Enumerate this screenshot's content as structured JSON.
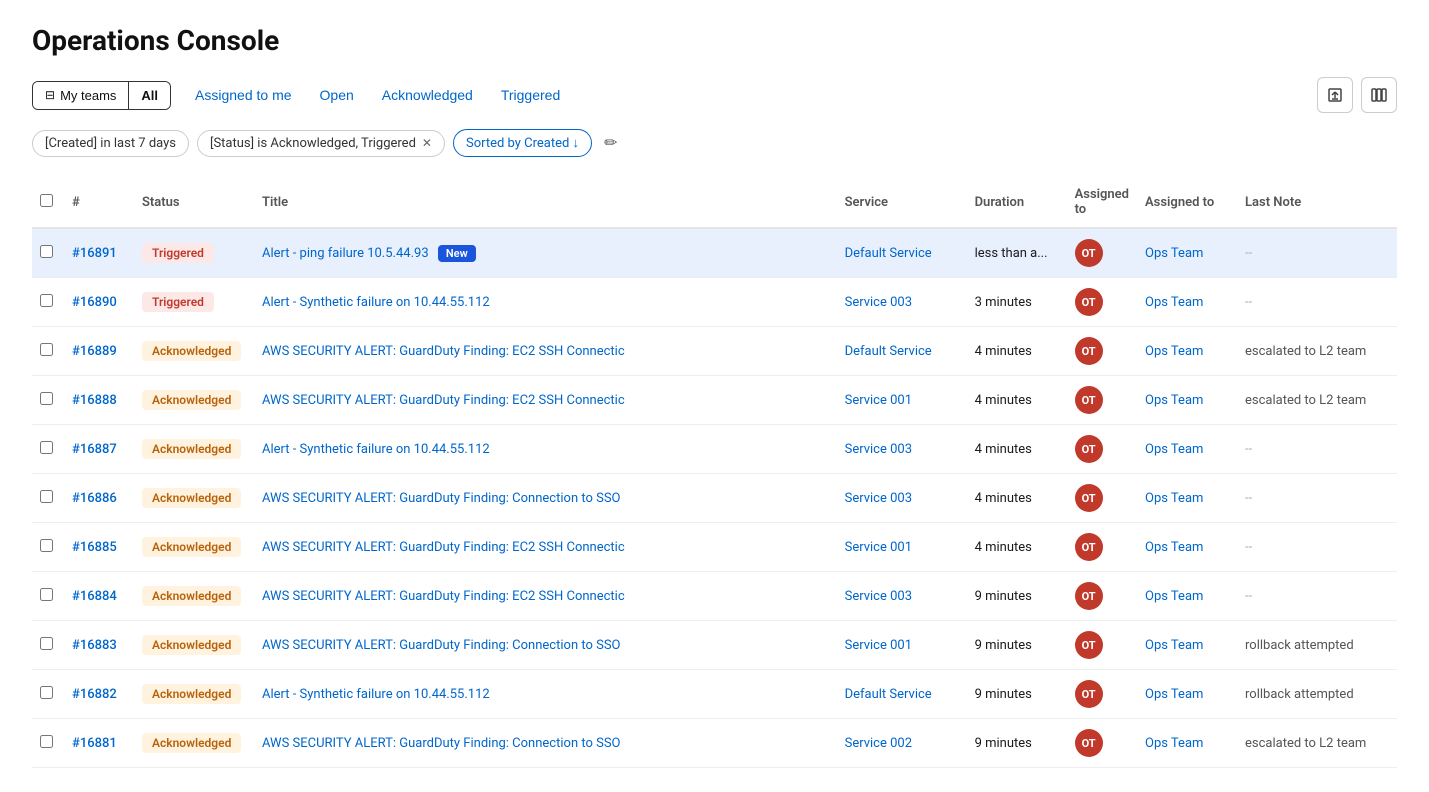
{
  "page": {
    "title": "Operations Console"
  },
  "topbar": {
    "myteams_label": "My teams",
    "all_label": "All",
    "tabs": [
      {
        "id": "assigned",
        "label": "Assigned to me"
      },
      {
        "id": "open",
        "label": "Open"
      },
      {
        "id": "acknowledged",
        "label": "Acknowledged"
      },
      {
        "id": "triggered",
        "label": "Triggered"
      }
    ]
  },
  "filters": {
    "created_chip": "[Created] in last 7 days",
    "status_chip": "[Status] is Acknowledged, Triggered",
    "sort_chip": "Sorted by Created ↓"
  },
  "table": {
    "columns": [
      "",
      "#",
      "Status",
      "Title",
      "Service",
      "Duration",
      "Assigned to",
      "Assigned to",
      "Last Note"
    ],
    "rows": [
      {
        "id": "#16891",
        "status": "Triggered",
        "status_type": "triggered",
        "title": "Alert - ping failure 10.5.44.93",
        "has_new": true,
        "service": "Default Service",
        "duration": "less than a...",
        "avatar": "OT",
        "assigned_team": "Ops Team",
        "last_note": "--",
        "highlighted": true
      },
      {
        "id": "#16890",
        "status": "Triggered",
        "status_type": "triggered",
        "title": "Alert - Synthetic failure on 10.44.55.112",
        "has_new": false,
        "service": "Service 003",
        "duration": "3 minutes",
        "avatar": "OT",
        "assigned_team": "Ops Team",
        "last_note": "--",
        "highlighted": false
      },
      {
        "id": "#16889",
        "status": "Acknowledged",
        "status_type": "acknowledged",
        "title": "AWS SECURITY ALERT: GuardDuty Finding: EC2 SSH Connectic",
        "has_new": false,
        "service": "Default Service",
        "duration": "4 minutes",
        "avatar": "OT",
        "assigned_team": "Ops Team",
        "last_note": "escalated to L2 team",
        "highlighted": false
      },
      {
        "id": "#16888",
        "status": "Acknowledged",
        "status_type": "acknowledged",
        "title": "AWS SECURITY ALERT: GuardDuty Finding: EC2 SSH Connectic",
        "has_new": false,
        "service": "Service 001",
        "duration": "4 minutes",
        "avatar": "OT",
        "assigned_team": "Ops Team",
        "last_note": "escalated to L2 team",
        "highlighted": false
      },
      {
        "id": "#16887",
        "status": "Acknowledged",
        "status_type": "acknowledged",
        "title": "Alert - Synthetic failure on 10.44.55.112",
        "has_new": false,
        "service": "Service 003",
        "duration": "4 minutes",
        "avatar": "OT",
        "assigned_team": "Ops Team",
        "last_note": "--",
        "highlighted": false
      },
      {
        "id": "#16886",
        "status": "Acknowledged",
        "status_type": "acknowledged",
        "title": "AWS SECURITY ALERT: GuardDuty Finding: Connection to SSO",
        "has_new": false,
        "service": "Service 003",
        "duration": "4 minutes",
        "avatar": "OT",
        "assigned_team": "Ops Team",
        "last_note": "--",
        "highlighted": false
      },
      {
        "id": "#16885",
        "status": "Acknowledged",
        "status_type": "acknowledged",
        "title": "AWS SECURITY ALERT: GuardDuty Finding: EC2 SSH Connectic",
        "has_new": false,
        "service": "Service 001",
        "duration": "4 minutes",
        "avatar": "OT",
        "assigned_team": "Ops Team",
        "last_note": "--",
        "highlighted": false
      },
      {
        "id": "#16884",
        "status": "Acknowledged",
        "status_type": "acknowledged",
        "title": "AWS SECURITY ALERT: GuardDuty Finding: EC2 SSH Connectic",
        "has_new": false,
        "service": "Service 003",
        "duration": "9 minutes",
        "avatar": "OT",
        "assigned_team": "Ops Team",
        "last_note": "--",
        "highlighted": false
      },
      {
        "id": "#16883",
        "status": "Acknowledged",
        "status_type": "acknowledged",
        "title": "AWS SECURITY ALERT: GuardDuty Finding: Connection to SSO",
        "has_new": false,
        "service": "Service 001",
        "duration": "9 minutes",
        "avatar": "OT",
        "assigned_team": "Ops Team",
        "last_note": "rollback attempted",
        "highlighted": false
      },
      {
        "id": "#16882",
        "status": "Acknowledged",
        "status_type": "acknowledged",
        "title": "Alert - Synthetic failure on 10.44.55.112",
        "has_new": false,
        "service": "Default Service",
        "duration": "9 minutes",
        "avatar": "OT",
        "assigned_team": "Ops Team",
        "last_note": "rollback attempted",
        "highlighted": false
      },
      {
        "id": "#16881",
        "status": "Acknowledged",
        "status_type": "acknowledged",
        "title": "AWS SECURITY ALERT: GuardDuty Finding: Connection to SSO",
        "has_new": false,
        "service": "Service 002",
        "duration": "9 minutes",
        "avatar": "OT",
        "assigned_team": "Ops Team",
        "last_note": "escalated to L2 team",
        "highlighted": false
      }
    ]
  }
}
